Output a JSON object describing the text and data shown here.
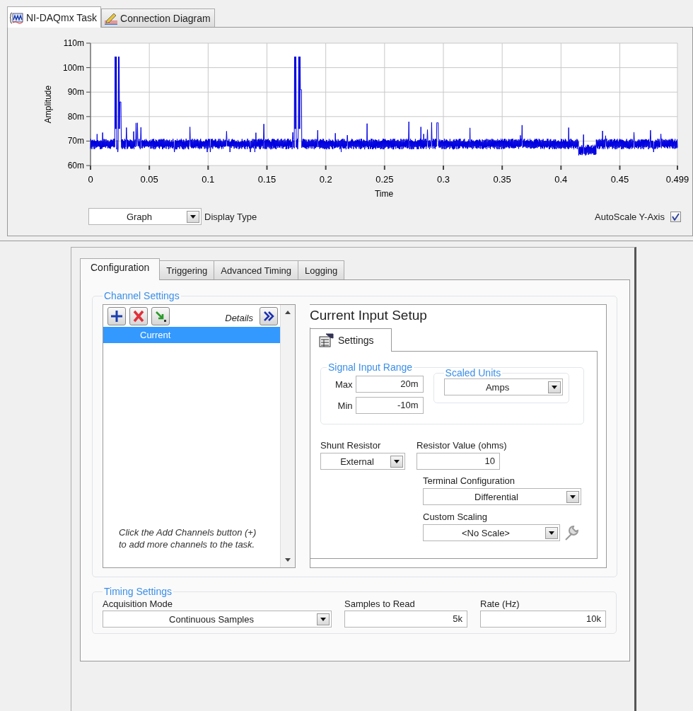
{
  "top_tabs": [
    {
      "label": "NI-DAQmx Task",
      "selected": true
    },
    {
      "label": "Connection Diagram",
      "selected": false
    }
  ],
  "graph": {
    "ylabel": "Amplitude",
    "xlabel": "Time",
    "y_ticks": [
      "110m",
      "100m",
      "90m",
      "80m",
      "70m",
      "60m"
    ],
    "x_ticks": [
      "0",
      "0.05",
      "0.1",
      "0.15",
      "0.2",
      "0.25",
      "0.3",
      "0.35",
      "0.4",
      "0.45",
      "0.499"
    ],
    "display_type": {
      "label": "Display Type",
      "value": "Graph"
    },
    "autoscale": {
      "label": "AutoScale Y-Axis",
      "checked": true
    }
  },
  "config_tabs": [
    {
      "label": "Configuration",
      "selected": true
    },
    {
      "label": "Triggering",
      "selected": false
    },
    {
      "label": "Advanced Timing",
      "selected": false
    },
    {
      "label": "Logging",
      "selected": false
    }
  ],
  "channel_settings": {
    "title": "Channel Settings",
    "details_label": "Details",
    "channels": [
      {
        "name": "Current",
        "selected": true
      }
    ],
    "hint": "Click the Add Channels button (+) to add more channels to the task."
  },
  "setup": {
    "title": "Current Input Setup",
    "tab": {
      "label": "Settings",
      "selected": true
    },
    "signal_range": {
      "title": "Signal Input Range",
      "max_label": "Max",
      "max": "20m",
      "min_label": "Min",
      "min": "-10m"
    },
    "scaled_units": {
      "title": "Scaled Units",
      "value": "Amps"
    },
    "shunt_resistor": {
      "label": "Shunt Resistor",
      "value": "External"
    },
    "resistor_value": {
      "label": "Resistor Value (ohms)",
      "value": "10"
    },
    "terminal_configuration": {
      "label": "Terminal Configuration",
      "value": "Differential"
    },
    "custom_scaling": {
      "label": "Custom Scaling",
      "value": "<No Scale>"
    }
  },
  "timing": {
    "title": "Timing Settings",
    "acquisition_mode": {
      "label": "Acquisition Mode",
      "value": "Continuous Samples"
    },
    "samples_to_read": {
      "label": "Samples to Read",
      "value": "5k"
    },
    "rate": {
      "label": "Rate (Hz)",
      "value": "10k"
    }
  }
}
